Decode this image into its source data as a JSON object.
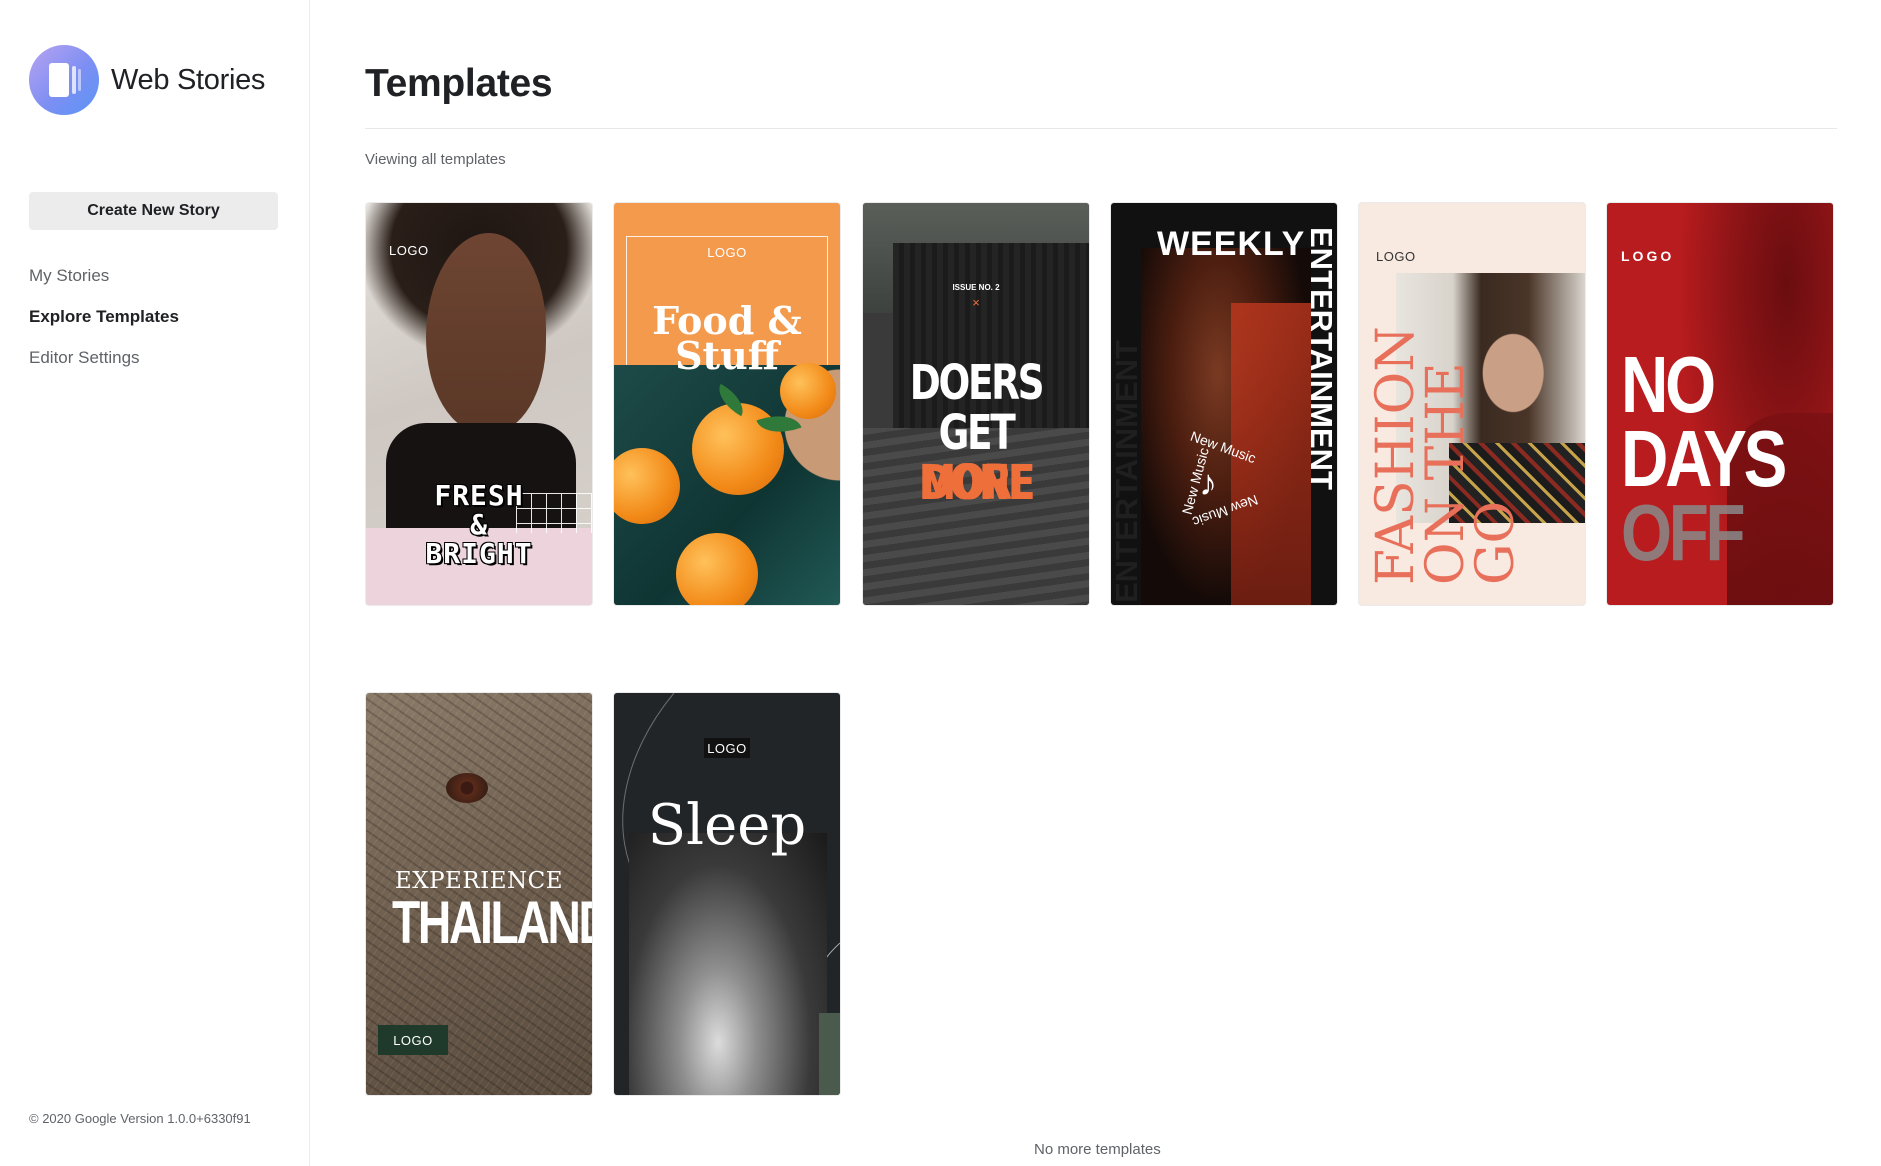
{
  "brand": {
    "name": "Web Stories"
  },
  "sidebar": {
    "create_button": "Create New Story",
    "nav": [
      {
        "label": "My Stories",
        "active": false
      },
      {
        "label": "Explore Templates",
        "active": true
      },
      {
        "label": "Editor Settings",
        "active": false
      }
    ],
    "footer": "© 2020 Google Version 1.0.0+6330f91"
  },
  "main": {
    "title": "Templates",
    "viewing_label": "Viewing all templates",
    "end_label": "No more templates"
  },
  "templates": [
    {
      "logo": "LOGO",
      "headline_lines": [
        "FRESH",
        "&",
        "BRIGHT"
      ]
    },
    {
      "logo": "LOGO",
      "headline_lines": [
        "Food &",
        "Stuff"
      ]
    },
    {
      "issue": "ISSUE NO. 2",
      "mark": "×",
      "headline_lines": [
        "DOERS",
        "GET",
        "MORE",
        "DONE"
      ]
    },
    {
      "headline_top": "WEEKLY",
      "headline_side": "ENTERTAINMENT",
      "badge_text": "New Music"
    },
    {
      "logo": "LOGO",
      "headline_lines": [
        "FASHION",
        "ON THE GO"
      ]
    },
    {
      "logo": "LOGO",
      "headline_lines": [
        "NO",
        "DAYS",
        "OFF"
      ]
    },
    {
      "logo": "LOGO",
      "headline_lines": [
        "EXPERIENCE",
        "THAILAND"
      ]
    },
    {
      "logo": "LOGO",
      "headline_lines": [
        "Sleep"
      ]
    }
  ]
}
